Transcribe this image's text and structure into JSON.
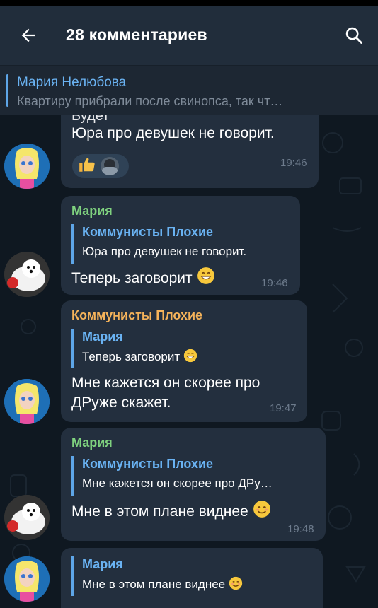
{
  "header": {
    "title": "28 комментариев"
  },
  "pinned": {
    "name": "Мария Нелюбова",
    "text": "Квартиру прибрали после свинопса, так чт…"
  },
  "messages": [
    {
      "partial_top": "Будет",
      "text": "Юра про девушек не говорит.",
      "time": "19:46",
      "reactions": [
        "thumbs-up",
        "avatar"
      ]
    },
    {
      "sender": "Мария",
      "sender_color": "#7fd27f",
      "reply_name": "Коммунисты Плохие",
      "reply_text": "Юра про девушек не говорит.",
      "text": "Теперь заговорит",
      "time": "19:46"
    },
    {
      "sender": "Коммунисты Плохие",
      "sender_color": "#f5b35a",
      "reply_name": "Мария",
      "reply_text": "Теперь заговорит",
      "text_line1": "Мне кажется он скорее про",
      "text_line2": "ДРуже скажет.",
      "time": "19:47"
    },
    {
      "sender": "Мария",
      "sender_color": "#7fd27f",
      "reply_name": "Коммунисты Плохие",
      "reply_text": "Мне кажется он скорее про ДРу…",
      "text": "Мне в этом плане виднее",
      "time": "19:48"
    },
    {
      "reply_name": "Мария",
      "reply_text": "Мне в этом плане виднее"
    }
  ],
  "colors": {
    "accent": "#6ab3f3",
    "bubble": "#232f3e",
    "header": "#212d3b"
  }
}
